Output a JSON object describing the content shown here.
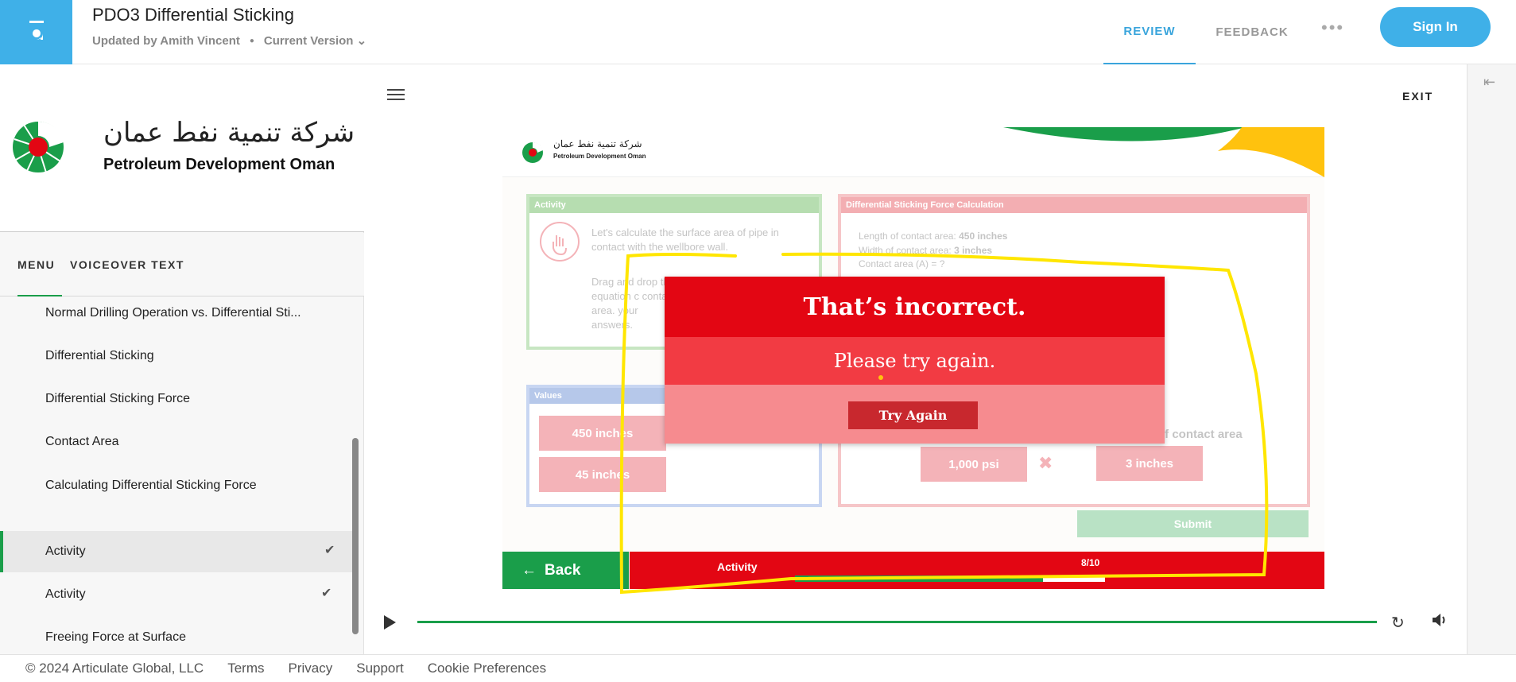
{
  "header": {
    "title": "PDO3 Differential Sticking",
    "updated_by": "Updated by Amith Vincent",
    "version": "Current Version",
    "nav_review": "REVIEW",
    "nav_feedback": "FEEDBACK",
    "sign_in": "Sign In"
  },
  "brand": {
    "arabic": "شركة تنمية نفط عمان",
    "english": "Petroleum Development Oman"
  },
  "sidebar": {
    "tabs": [
      "MENU",
      "VOICEOVER TEXT"
    ],
    "items": [
      {
        "label": "Normal Drilling Operation vs. Differential Sti..."
      },
      {
        "label": "Differential Sticking"
      },
      {
        "label": "Differential Sticking Force"
      },
      {
        "label": "Contact Area"
      },
      {
        "label": "Calculating Differential Sticking Force"
      },
      {
        "label": "Activity",
        "completed": true,
        "active": true
      },
      {
        "label": "Activity",
        "completed": true
      },
      {
        "label": "Freeing Force at Surface"
      }
    ]
  },
  "content": {
    "exit": "EXIT"
  },
  "slide": {
    "logo_arabic": "شركة تنمية نفط عمان",
    "logo_english": "Petroleum Development Oman",
    "activity_panel": {
      "title": "Activity",
      "text1": "Let's calculate the surface area of pipe in contact with the wellbore wall.",
      "text2": "Drag and drop the equation c contact area. your answers."
    },
    "dsf_panel": {
      "title": "Differential Sticking Force Calculation",
      "length": "Length of contact area:",
      "length_value": "450 inches",
      "width": "Width of contact area:",
      "width_value": "3 inches",
      "area": "Contact area (A) = ?",
      "contact_area_label": "of contact area",
      "chip_psi": "1,000 psi",
      "chip_inches": "3 inches",
      "times": "✖"
    },
    "values_panel": {
      "title": "Values",
      "chips": [
        "450 inches",
        "45 inches"
      ]
    },
    "submit": "Submit",
    "back": "Back",
    "footer_title": "Activity",
    "footer_count": "8/10",
    "progress": 0.8
  },
  "feedback": {
    "title": "That’s incorrect.",
    "message": "Please try again.",
    "button": "Try Again"
  },
  "footer": {
    "copyright": "© 2024 Articulate Global, LLC",
    "links": [
      "Terms",
      "Privacy",
      "Support",
      "Cookie Preferences"
    ]
  },
  "colors": {
    "brand_blue": "#3fb0e8",
    "pdo_green": "#1a9e4a",
    "pdo_red": "#e30613",
    "annotation_yellow": "#ffe600"
  }
}
